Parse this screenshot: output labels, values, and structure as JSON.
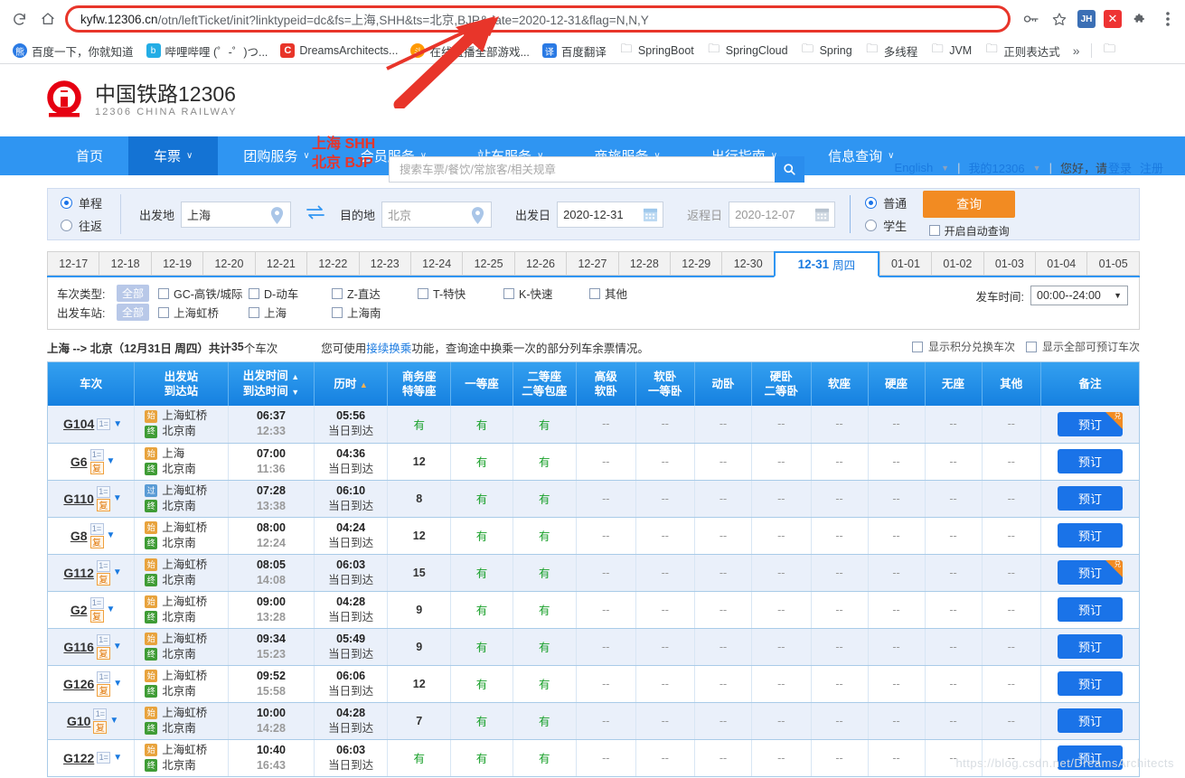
{
  "browser": {
    "url_parts": [
      {
        "t": "kyfw.12306.cn",
        "dark": true
      },
      {
        "t": "/otn/leftTicket/init?linktypeid=dc&fs=上海,SHH&ts=北京,BJP&date=2020-12-31&flag=N,N,Y",
        "dark": false
      }
    ],
    "url_full": "kyfw.12306.cn/otn/leftTicket/init?linktypeid=dc&fs=上海,SHH&ts=北京,BJP&date=2020-12-31&flag=N,N,Y",
    "reload_icon": "reload-icon",
    "home_icon": "home-icon",
    "profile_initials": "JH",
    "bookmarks": [
      {
        "label": "百度一下，你就知道",
        "icon": "baidu-icon",
        "type": "site"
      },
      {
        "label": "哔哩哔哩 (゜-゜)つ...",
        "icon": "bilibili-icon",
        "type": "site"
      },
      {
        "label": "DreamsArchitects...",
        "icon": "csdn-icon",
        "type": "site"
      },
      {
        "label": "在线直播全部游戏...",
        "icon": "douyu-icon",
        "type": "site"
      },
      {
        "label": "百度翻译",
        "icon": "fanyi-icon",
        "type": "site"
      },
      {
        "label": "SpringBoot",
        "icon": "folder-icon",
        "type": "folder"
      },
      {
        "label": "SpringCloud",
        "icon": "folder-icon",
        "type": "folder"
      },
      {
        "label": "Spring",
        "icon": "folder-icon",
        "type": "folder"
      },
      {
        "label": "多线程",
        "icon": "folder-icon",
        "type": "folder"
      },
      {
        "label": "JVM",
        "icon": "folder-icon",
        "type": "folder"
      },
      {
        "label": "正则表达式",
        "icon": "folder-icon",
        "type": "folder"
      }
    ],
    "overflow_label": "»"
  },
  "annotation": {
    "line1": "上海 SHH",
    "line2": "北京 BJP"
  },
  "site": {
    "logo_cn": "中国铁路12306",
    "logo_en": "12306 CHINA RAILWAY",
    "search_placeholder": "搜索车票/餐饮/常旅客/相关规章",
    "search_value": "",
    "english_label": "English",
    "my12306_label": "我的12306",
    "greeting": "您好，请",
    "login_label": "登录",
    "register_label": "注册"
  },
  "nav": {
    "items": [
      {
        "label": "首页",
        "caret": false,
        "active": false
      },
      {
        "label": "车票",
        "caret": true,
        "active": true
      },
      {
        "label": "团购服务",
        "caret": true,
        "active": false
      },
      {
        "label": "会员服务",
        "caret": true,
        "active": false
      },
      {
        "label": "站车服务",
        "caret": true,
        "active": false
      },
      {
        "label": "商旅服务",
        "caret": true,
        "active": false
      },
      {
        "label": "出行指南",
        "caret": true,
        "active": false
      },
      {
        "label": "信息查询",
        "caret": true,
        "active": false
      }
    ]
  },
  "searchform": {
    "trip_oneway": "单程",
    "trip_round": "往返",
    "trip_selected": "单程",
    "from_label": "出发地",
    "from_value": "上海",
    "to_label": "目的地",
    "to_value": "北京",
    "depart_label": "出发日",
    "depart_value": "2020-12-31",
    "return_label": "返程日",
    "return_value": "2020-12-07",
    "pax_normal": "普通",
    "pax_student": "学生",
    "pax_selected": "普通",
    "query_label": "查询",
    "auto_query_label": "开启自动查询",
    "auto_query_checked": false,
    "swap_icon": "swap-arrows-icon"
  },
  "datetabs": {
    "items": [
      {
        "label": "12-17",
        "active": false
      },
      {
        "label": "12-18",
        "active": false
      },
      {
        "label": "12-19",
        "active": false
      },
      {
        "label": "12-20",
        "active": false
      },
      {
        "label": "12-21",
        "active": false
      },
      {
        "label": "12-22",
        "active": false
      },
      {
        "label": "12-23",
        "active": false
      },
      {
        "label": "12-24",
        "active": false
      },
      {
        "label": "12-25",
        "active": false
      },
      {
        "label": "12-26",
        "active": false
      },
      {
        "label": "12-27",
        "active": false
      },
      {
        "label": "12-28",
        "active": false
      },
      {
        "label": "12-29",
        "active": false
      },
      {
        "label": "12-30",
        "active": false
      },
      {
        "label": "12-31",
        "weekday": "周四",
        "active": true
      },
      {
        "label": "01-01",
        "active": false
      },
      {
        "label": "01-02",
        "active": false
      },
      {
        "label": "01-03",
        "active": false
      },
      {
        "label": "01-04",
        "active": false
      },
      {
        "label": "01-05",
        "active": false
      }
    ]
  },
  "filters": {
    "train_type_label": "车次类型:",
    "train_type_all": "全部",
    "train_types": [
      "GC-高铁/城际",
      "D-动车",
      "Z-直达",
      "T-特快",
      "K-快速",
      "其他"
    ],
    "station_label": "出发车站:",
    "station_all": "全部",
    "stations": [
      "上海虹桥",
      "上海",
      "上海南"
    ],
    "depart_time_label": "发车时间:",
    "depart_time_value": "00:00--24:00"
  },
  "summary": {
    "route": "上海 --> 北京",
    "date_part": "（12月31日 周四）共计",
    "count": "35",
    "count_suffix": "个车次",
    "hint_pre": "您可使用",
    "hint_link": "接续换乘",
    "hint_post": "功能，查询途中换乘一次的部分列车余票情况。",
    "chk_points": "显示积分兑换车次",
    "chk_all_bookable": "显示全部可预订车次"
  },
  "table": {
    "headers": [
      {
        "l1": "车次",
        "l2": "",
        "sort": ""
      },
      {
        "l1": "出发站",
        "l2": "到达站",
        "sort": ""
      },
      {
        "l1": "出发时间",
        "l2": "到达时间",
        "sort": "both"
      },
      {
        "l1": "历时",
        "l2": "",
        "sort": "up-orange"
      },
      {
        "l1": "商务座",
        "l2": "特等座",
        "sort": ""
      },
      {
        "l1": "一等座",
        "l2": "",
        "sort": ""
      },
      {
        "l1": "二等座",
        "l2": "二等包座",
        "sort": ""
      },
      {
        "l1": "高级",
        "l2": "软卧",
        "sort": ""
      },
      {
        "l1": "软卧",
        "l2": "一等卧",
        "sort": ""
      },
      {
        "l1": "动卧",
        "l2": "",
        "sort": ""
      },
      {
        "l1": "硬卧",
        "l2": "二等卧",
        "sort": ""
      },
      {
        "l1": "软座",
        "l2": "",
        "sort": ""
      },
      {
        "l1": "硬座",
        "l2": "",
        "sort": ""
      },
      {
        "l1": "无座",
        "l2": "",
        "sort": ""
      },
      {
        "l1": "其他",
        "l2": "",
        "sort": ""
      },
      {
        "l1": "备注",
        "l2": "",
        "sort": ""
      }
    ],
    "book_label": "预订",
    "exchange_badge": "兑",
    "arrive_same_day": "当日到达",
    "rows": [
      {
        "train": "G104",
        "has_fu": false,
        "from_tag": "始",
        "from": "上海虹桥",
        "to_tag": "终",
        "to": "北京南",
        "dep": "06:37",
        "arr": "12:33",
        "dur": "05:56",
        "seats": [
          "有",
          "有",
          "有",
          "--",
          "--",
          "--",
          "--",
          "--",
          "--",
          "--",
          "--"
        ],
        "badge": true
      },
      {
        "train": "G6",
        "has_fu": true,
        "from_tag": "始",
        "from": "上海",
        "to_tag": "终",
        "to": "北京南",
        "dep": "07:00",
        "arr": "11:36",
        "dur": "04:36",
        "seats": [
          "12",
          "有",
          "有",
          "--",
          "--",
          "--",
          "--",
          "--",
          "--",
          "--",
          "--"
        ],
        "badge": false
      },
      {
        "train": "G110",
        "has_fu": true,
        "from_tag": "过",
        "from": "上海虹桥",
        "to_tag": "终",
        "to": "北京南",
        "dep": "07:28",
        "arr": "13:38",
        "dur": "06:10",
        "seats": [
          "8",
          "有",
          "有",
          "--",
          "--",
          "--",
          "--",
          "--",
          "--",
          "--",
          "--"
        ],
        "badge": false
      },
      {
        "train": "G8",
        "has_fu": true,
        "from_tag": "始",
        "from": "上海虹桥",
        "to_tag": "终",
        "to": "北京南",
        "dep": "08:00",
        "arr": "12:24",
        "dur": "04:24",
        "seats": [
          "12",
          "有",
          "有",
          "--",
          "--",
          "--",
          "--",
          "--",
          "--",
          "--",
          "--"
        ],
        "badge": false
      },
      {
        "train": "G112",
        "has_fu": true,
        "from_tag": "始",
        "from": "上海虹桥",
        "to_tag": "终",
        "to": "北京南",
        "dep": "08:05",
        "arr": "14:08",
        "dur": "06:03",
        "seats": [
          "15",
          "有",
          "有",
          "--",
          "--",
          "--",
          "--",
          "--",
          "--",
          "--",
          "--"
        ],
        "badge": true
      },
      {
        "train": "G2",
        "has_fu": true,
        "from_tag": "始",
        "from": "上海虹桥",
        "to_tag": "终",
        "to": "北京南",
        "dep": "09:00",
        "arr": "13:28",
        "dur": "04:28",
        "seats": [
          "9",
          "有",
          "有",
          "--",
          "--",
          "--",
          "--",
          "--",
          "--",
          "--",
          "--"
        ],
        "badge": false
      },
      {
        "train": "G116",
        "has_fu": true,
        "from_tag": "始",
        "from": "上海虹桥",
        "to_tag": "终",
        "to": "北京南",
        "dep": "09:34",
        "arr": "15:23",
        "dur": "05:49",
        "seats": [
          "9",
          "有",
          "有",
          "--",
          "--",
          "--",
          "--",
          "--",
          "--",
          "--",
          "--"
        ],
        "badge": false
      },
      {
        "train": "G126",
        "has_fu": true,
        "from_tag": "始",
        "from": "上海虹桥",
        "to_tag": "终",
        "to": "北京南",
        "dep": "09:52",
        "arr": "15:58",
        "dur": "06:06",
        "seats": [
          "12",
          "有",
          "有",
          "--",
          "--",
          "--",
          "--",
          "--",
          "--",
          "--",
          "--"
        ],
        "badge": false
      },
      {
        "train": "G10",
        "has_fu": true,
        "from_tag": "始",
        "from": "上海虹桥",
        "to_tag": "终",
        "to": "北京南",
        "dep": "10:00",
        "arr": "14:28",
        "dur": "04:28",
        "seats": [
          "7",
          "有",
          "有",
          "--",
          "--",
          "--",
          "--",
          "--",
          "--",
          "--",
          "--"
        ],
        "badge": false
      },
      {
        "train": "G122",
        "has_fu": false,
        "from_tag": "始",
        "from": "上海虹桥",
        "to_tag": "终",
        "to": "北京南",
        "dep": "10:40",
        "arr": "16:43",
        "dur": "06:03",
        "seats": [
          "有",
          "有",
          "有",
          "--",
          "--",
          "--",
          "--",
          "--",
          "--",
          "--",
          "--"
        ],
        "badge": false
      }
    ]
  },
  "watermark": "https://blog.csdn.net/DreamsArchitects"
}
